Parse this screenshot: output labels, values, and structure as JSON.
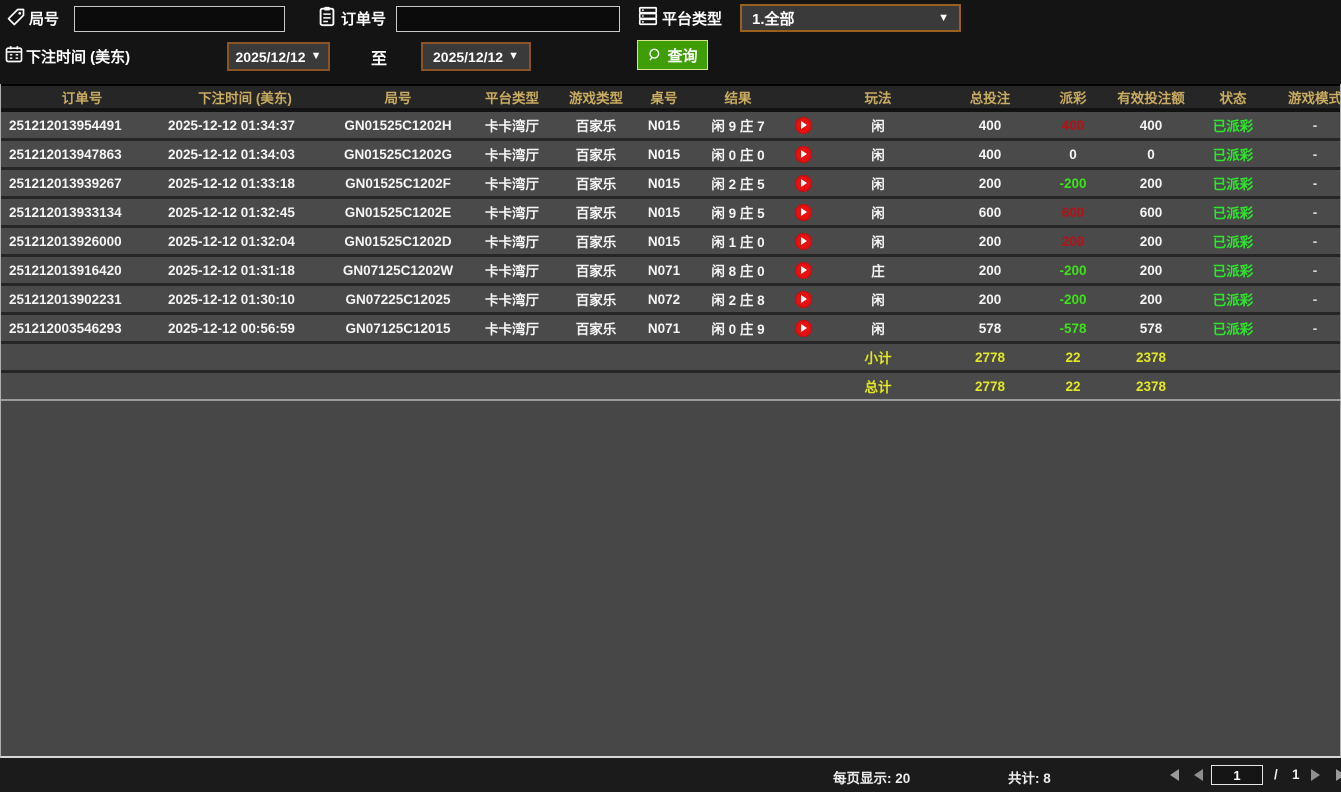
{
  "filters": {
    "round_label": "局号",
    "round_value": "",
    "order_label": "订单号",
    "order_value": "",
    "platform_label": "平台类型",
    "platform_value": "1.全部",
    "bet_time_label": "下注时间 (美东)",
    "date_from": "2025/12/12",
    "range_to_label": "至",
    "date_to": "2025/12/12",
    "query_label": "查询"
  },
  "icons": {
    "dropdown_arrow": "▼"
  },
  "table": {
    "headers": [
      "订单号",
      "下注时间 (美东)",
      "局号",
      "平台类型",
      "游戏类型",
      "桌号",
      "结果",
      "玩法",
      "总投注",
      "派彩",
      "有效投注额",
      "状态",
      "游戏模式"
    ],
    "rows": [
      {
        "order_id": "251212013954491",
        "bet_time": "2025-12-12 01:34:37",
        "round_no": "GN01525C1202H",
        "platform": "卡卡湾厅",
        "game_type": "百家乐",
        "table_no": "N015",
        "result": "闲 9 庄 7",
        "play_method": "闲",
        "total_bet": "400",
        "payout": "400",
        "valid_bet": "400",
        "status": "已派彩",
        "mode": "-"
      },
      {
        "order_id": "251212013947863",
        "bet_time": "2025-12-12 01:34:03",
        "round_no": "GN01525C1202G",
        "platform": "卡卡湾厅",
        "game_type": "百家乐",
        "table_no": "N015",
        "result": "闲 0 庄 0",
        "play_method": "闲",
        "total_bet": "400",
        "payout": "0",
        "valid_bet": "0",
        "status": "已派彩",
        "mode": "-"
      },
      {
        "order_id": "251212013939267",
        "bet_time": "2025-12-12 01:33:18",
        "round_no": "GN01525C1202F",
        "platform": "卡卡湾厅",
        "game_type": "百家乐",
        "table_no": "N015",
        "result": "闲 2 庄 5",
        "play_method": "闲",
        "total_bet": "200",
        "payout": "-200",
        "valid_bet": "200",
        "status": "已派彩",
        "mode": "-"
      },
      {
        "order_id": "251212013933134",
        "bet_time": "2025-12-12 01:32:45",
        "round_no": "GN01525C1202E",
        "platform": "卡卡湾厅",
        "game_type": "百家乐",
        "table_no": "N015",
        "result": "闲 9 庄 5",
        "play_method": "闲",
        "total_bet": "600",
        "payout": "600",
        "valid_bet": "600",
        "status": "已派彩",
        "mode": "-"
      },
      {
        "order_id": "251212013926000",
        "bet_time": "2025-12-12 01:32:04",
        "round_no": "GN01525C1202D",
        "platform": "卡卡湾厅",
        "game_type": "百家乐",
        "table_no": "N015",
        "result": "闲 1 庄 0",
        "play_method": "闲",
        "total_bet": "200",
        "payout": "200",
        "valid_bet": "200",
        "status": "已派彩",
        "mode": "-"
      },
      {
        "order_id": "251212013916420",
        "bet_time": "2025-12-12 01:31:18",
        "round_no": "GN07125C1202W",
        "platform": "卡卡湾厅",
        "game_type": "百家乐",
        "table_no": "N071",
        "result": "闲 8 庄 0",
        "play_method": "庄",
        "total_bet": "200",
        "payout": "-200",
        "valid_bet": "200",
        "status": "已派彩",
        "mode": "-"
      },
      {
        "order_id": "251212013902231",
        "bet_time": "2025-12-12 01:30:10",
        "round_no": "GN07225C12025",
        "platform": "卡卡湾厅",
        "game_type": "百家乐",
        "table_no": "N072",
        "result": "闲 2 庄 8",
        "play_method": "闲",
        "total_bet": "200",
        "payout": "-200",
        "valid_bet": "200",
        "status": "已派彩",
        "mode": "-"
      },
      {
        "order_id": "251212003546293",
        "bet_time": "2025-12-12 00:56:59",
        "round_no": "GN07125C12015",
        "platform": "卡卡湾厅",
        "game_type": "百家乐",
        "table_no": "N071",
        "result": "闲 0 庄 9",
        "play_method": "闲",
        "total_bet": "578",
        "payout": "-578",
        "valid_bet": "578",
        "status": "已派彩",
        "mode": "-"
      }
    ],
    "subtotal": {
      "label": "小计",
      "total_bet": "2778",
      "payout": "22",
      "valid_bet": "2378"
    },
    "grand_total": {
      "label": "总计",
      "total_bet": "2778",
      "payout": "22",
      "valid_bet": "2378"
    }
  },
  "footer": {
    "page_size_text": "每页显示: 20",
    "total_count_text": "共计: 8",
    "current_page": "1",
    "page_separator": "/",
    "total_pages": "1"
  },
  "colors": {
    "accent_green": "#3f9d08",
    "date_border_brown": "#8a5424",
    "header_gold": "#c9ab61",
    "payout_positive": "#b31217",
    "payout_negative": "#3fe01c",
    "status_paid_green": "#2ee52e",
    "summary_yellow": "#e3e822"
  }
}
